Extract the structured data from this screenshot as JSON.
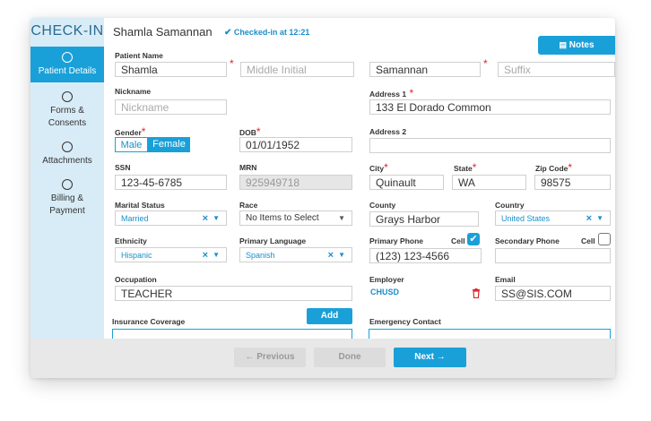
{
  "sidebar": {
    "title": "CHECK-IN",
    "items": [
      {
        "label": "Patient Details"
      },
      {
        "label_l1": "Forms &",
        "label_l2": "Consents"
      },
      {
        "label": "Attachments"
      },
      {
        "label_l1": "Billing &",
        "label_l2": "Payment"
      }
    ]
  },
  "header": {
    "patient_name": "Shamla Samannan",
    "status": "Checked-in at 12:21",
    "notes_label": "Notes"
  },
  "form": {
    "patient_name_label": "Patient Name",
    "first_name": "Shamla",
    "middle_placeholder": "Middle Initial",
    "last_name": "Samannan",
    "suffix_placeholder": "Suffix",
    "nickname_label": "Nickname",
    "nickname_placeholder": "Nickname",
    "address1_label": "Address 1",
    "address1": "133 El Dorado Common",
    "gender_label": "Gender",
    "gender_male": "Male",
    "gender_female": "Female",
    "dob_label": "DOB",
    "dob": "01/01/1952",
    "address2_label": "Address 2",
    "address2": "",
    "ssn_label": "SSN",
    "ssn": "123-45-6785",
    "mrn_label": "MRN",
    "mrn": "925949718",
    "city_label": "City",
    "city": "Quinault",
    "state_label": "State",
    "state": "WA",
    "zip_label": "Zip Code",
    "zip": "98575",
    "marital_label": "Marital Status",
    "marital": "Married",
    "race_label": "Race",
    "race_placeholder": "No Items to Select",
    "county_label": "County",
    "county": "Grays Harbor",
    "country_label": "Country",
    "country": "United States",
    "ethnicity_label": "Ethnicity",
    "ethnicity": "Hispanic",
    "language_label": "Primary Language",
    "language": "Spanish",
    "primary_phone_label": "Primary Phone",
    "primary_phone": "(123) 123-4566",
    "cell_label": "Cell",
    "secondary_phone_label": "Secondary Phone",
    "secondary_phone": "",
    "occupation_label": "Occupation",
    "occupation": "TEACHER",
    "employer_label": "Employer",
    "employer": "CHUSD",
    "email_label": "Email",
    "email": "SS@SIS.COM",
    "insurance_label": "Insurance Coverage",
    "add_label": "Add",
    "emergency_label": "Emergency Contact"
  },
  "footer": {
    "previous": "Previous",
    "done": "Done",
    "next": "Next"
  },
  "colors": {
    "accent": "#1aa0d8",
    "sidebar_bg": "#d8ecf7",
    "required": "#e0232a"
  }
}
